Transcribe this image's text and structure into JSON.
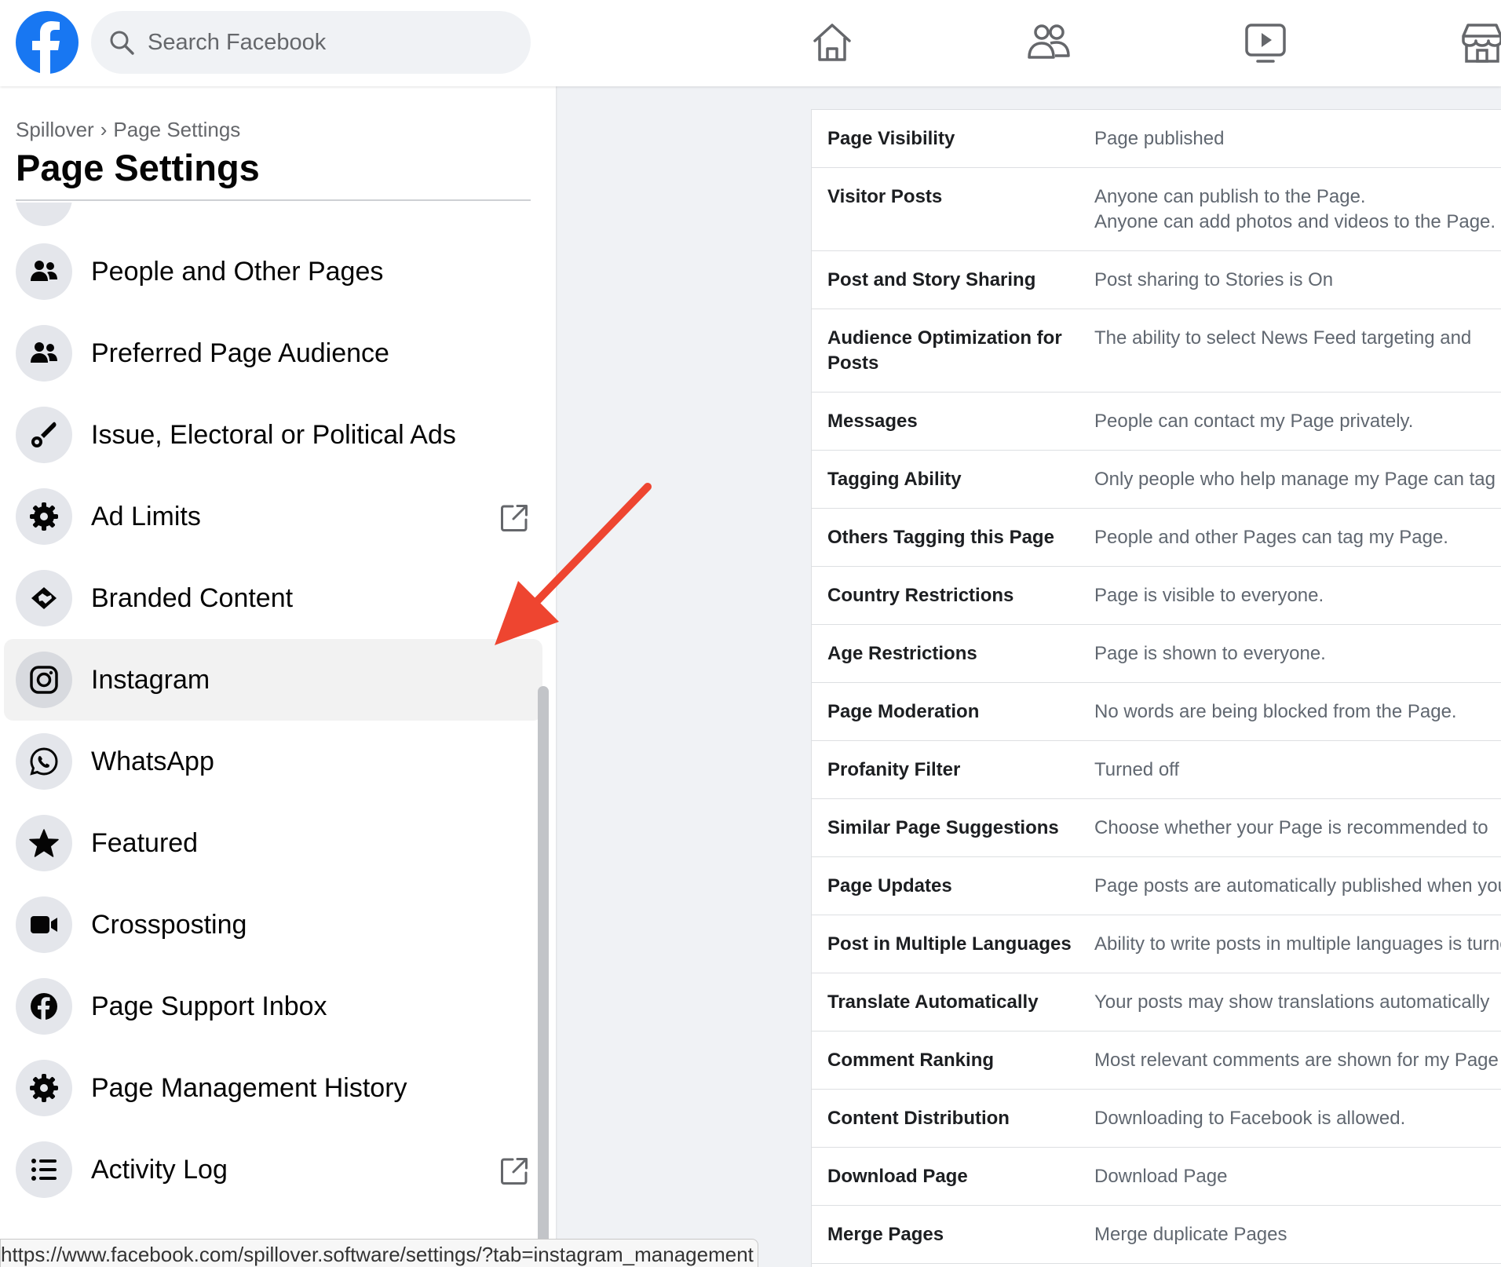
{
  "colors": {
    "brand": "#1877f2",
    "arrow": "#ee4530",
    "nav_icon": "#65676b",
    "sidebar_icon": "#050505"
  },
  "header": {
    "search_placeholder": "Search Facebook",
    "logo_icon": "facebook-logo-icon",
    "nav_icons": [
      "home-icon",
      "friends-icon",
      "watch-icon",
      "marketplace-icon"
    ]
  },
  "sidebar": {
    "breadcrumb": {
      "parent": "Spillover",
      "separator": "›",
      "current": "Page Settings"
    },
    "title": "Page Settings",
    "items": [
      {
        "label": "People and Other Pages",
        "icon": "people-icon",
        "external": false,
        "active": false
      },
      {
        "label": "Preferred Page Audience",
        "icon": "people-icon",
        "external": false,
        "active": false
      },
      {
        "label": "Issue, Electoral or Political Ads",
        "icon": "brush-icon",
        "external": false,
        "active": false
      },
      {
        "label": "Ad Limits",
        "icon": "gear-icon",
        "external": true,
        "active": false
      },
      {
        "label": "Branded Content",
        "icon": "handshake-icon",
        "external": false,
        "active": false
      },
      {
        "label": "Instagram",
        "icon": "instagram-icon",
        "external": false,
        "active": true
      },
      {
        "label": "WhatsApp",
        "icon": "whatsapp-icon",
        "external": false,
        "active": false
      },
      {
        "label": "Featured",
        "icon": "star-icon",
        "external": false,
        "active": false
      },
      {
        "label": "Crossposting",
        "icon": "video-camera-icon",
        "external": false,
        "active": false
      },
      {
        "label": "Page Support Inbox",
        "icon": "facebook-circle-icon",
        "external": false,
        "active": false
      },
      {
        "label": "Page Management History",
        "icon": "gear-icon",
        "external": false,
        "active": false
      },
      {
        "label": "Activity Log",
        "icon": "list-icon",
        "external": true,
        "active": false
      }
    ]
  },
  "settings": {
    "rows": [
      {
        "key": "Page Visibility",
        "value": [
          "Page published"
        ]
      },
      {
        "key": "Visitor Posts",
        "value": [
          "Anyone can publish to the Page.",
          "Anyone can add photos and videos to the Page."
        ]
      },
      {
        "key": "Post and Story Sharing",
        "value": [
          "Post sharing to Stories is On"
        ]
      },
      {
        "key": [
          "Audience Optimization for",
          "Posts"
        ],
        "value": [
          "The ability to select News Feed targeting and"
        ]
      },
      {
        "key": "Messages",
        "value": [
          "People can contact my Page privately."
        ]
      },
      {
        "key": "Tagging Ability",
        "value": [
          "Only people who help manage my Page can tag"
        ]
      },
      {
        "key": "Others Tagging this Page",
        "value": [
          "People and other Pages can tag my Page."
        ]
      },
      {
        "key": "Country Restrictions",
        "value": [
          "Page is visible to everyone."
        ]
      },
      {
        "key": "Age Restrictions",
        "value": [
          "Page is shown to everyone."
        ]
      },
      {
        "key": "Page Moderation",
        "value": [
          "No words are being blocked from the Page."
        ]
      },
      {
        "key": "Profanity Filter",
        "value": [
          "Turned off"
        ]
      },
      {
        "key": "Similar Page Suggestions",
        "value": [
          "Choose whether your Page is recommended to"
        ]
      },
      {
        "key": "Page Updates",
        "value": [
          "Page posts are automatically published when you"
        ]
      },
      {
        "key": "Post in Multiple Languages",
        "value": [
          "Ability to write posts in multiple languages is turned"
        ]
      },
      {
        "key": "Translate Automatically",
        "value": [
          "Your posts may show translations automatically"
        ]
      },
      {
        "key": "Comment Ranking",
        "value": [
          "Most relevant comments are shown for my Page"
        ]
      },
      {
        "key": "Content Distribution",
        "value": [
          "Downloading to Facebook is allowed."
        ]
      },
      {
        "key": "Download Page",
        "value": [
          "Download Page"
        ]
      },
      {
        "key": "Merge Pages",
        "value": [
          "Merge duplicate Pages"
        ]
      }
    ]
  },
  "status_bar": {
    "url": "https://www.facebook.com/spillover.software/settings/?tab=instagram_management"
  }
}
